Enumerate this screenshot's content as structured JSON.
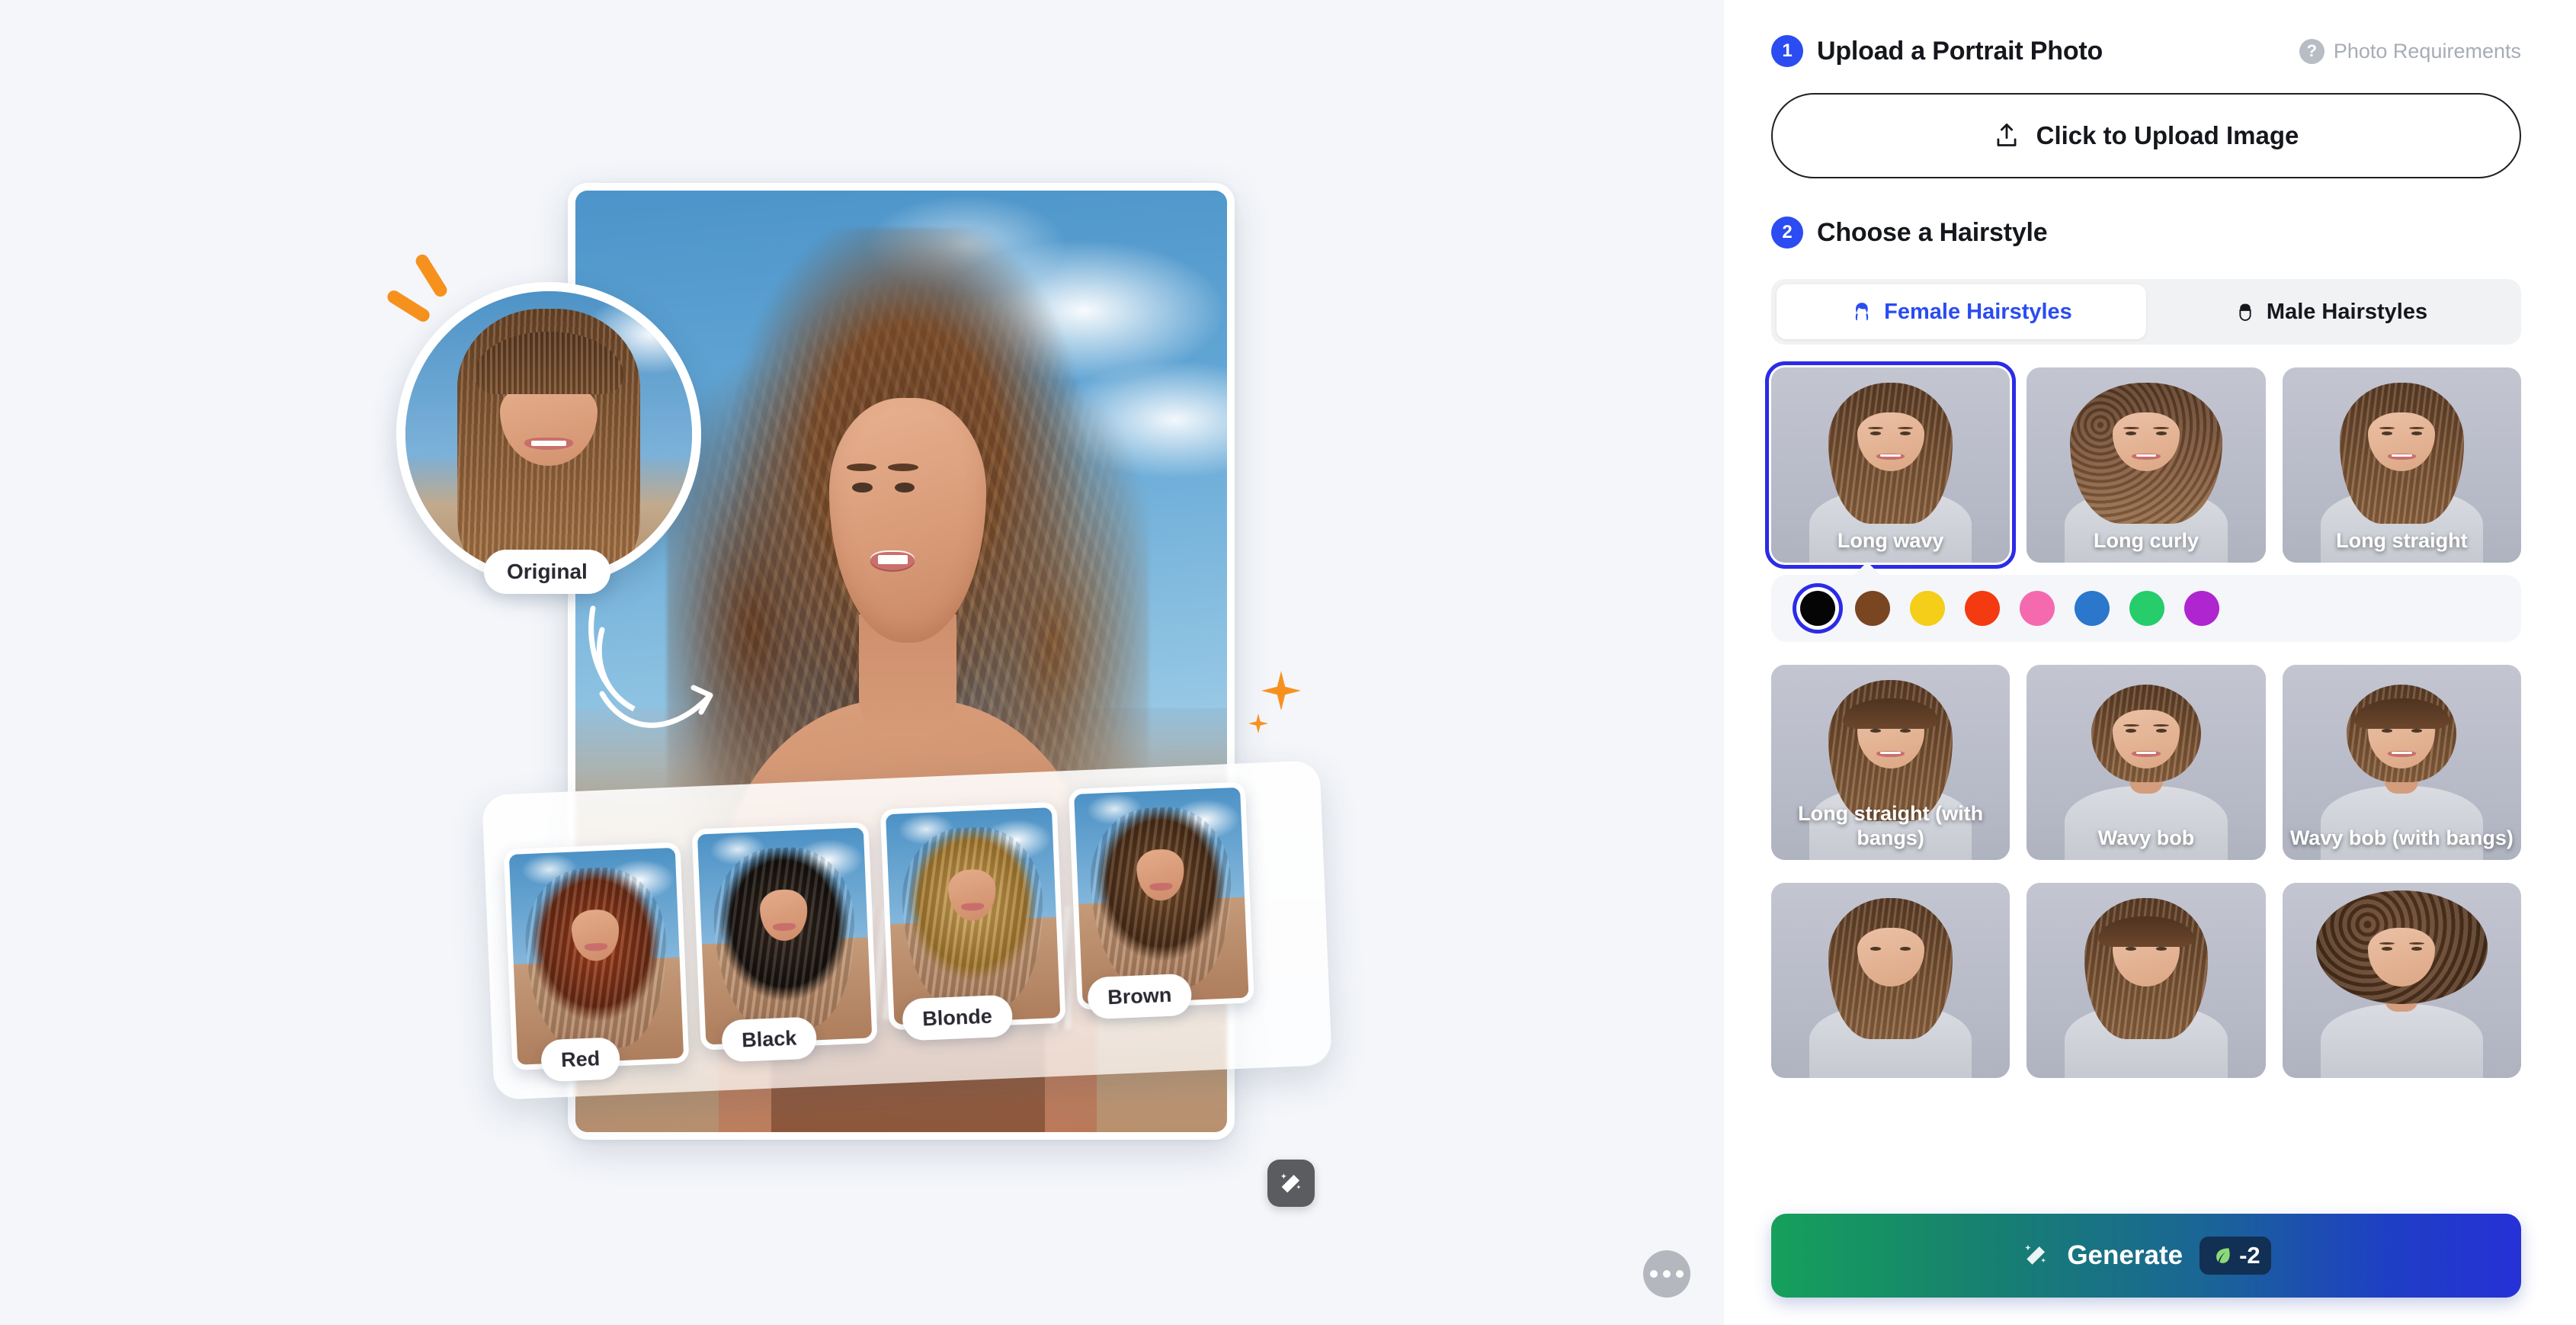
{
  "steps": {
    "one": {
      "num": "1",
      "title": "Upload a Portrait Photo"
    },
    "two": {
      "num": "2",
      "title": "Choose a Hairstyle"
    }
  },
  "photo_requirements": {
    "label": "Photo Requirements",
    "icon": "question-mark-icon"
  },
  "upload": {
    "label": "Click to Upload Image",
    "icon": "upload-icon"
  },
  "tabs": [
    {
      "label": "Female Hairstyles",
      "icon": "female-hair-icon",
      "active": true
    },
    {
      "label": "Male Hairstyles",
      "icon": "male-hair-icon",
      "active": false
    }
  ],
  "hairstyles_row1": [
    {
      "label": "Long wavy",
      "selected": true
    },
    {
      "label": "Long curly",
      "selected": false
    },
    {
      "label": "Long straight",
      "selected": false
    }
  ],
  "hairstyles_row2": [
    {
      "label": "Long straight (with bangs)",
      "selected": false
    },
    {
      "label": "Wavy bob",
      "selected": false
    },
    {
      "label": "Wavy bob (with bangs)",
      "selected": false
    }
  ],
  "hairstyles_row3": [
    {
      "label": "",
      "selected": false
    },
    {
      "label": "",
      "selected": false
    },
    {
      "label": "",
      "selected": false
    }
  ],
  "hair_colors": [
    {
      "name": "black",
      "hex": "#050505",
      "selected": true
    },
    {
      "name": "brown",
      "hex": "#7A4521",
      "selected": false
    },
    {
      "name": "yellow",
      "hex": "#F5CE19",
      "selected": false
    },
    {
      "name": "red",
      "hex": "#F43A10",
      "selected": false
    },
    {
      "name": "pink",
      "hex": "#F56AAE",
      "selected": false
    },
    {
      "name": "blue",
      "hex": "#2A77CC",
      "selected": false
    },
    {
      "name": "green",
      "hex": "#27CC6B",
      "selected": false
    },
    {
      "name": "purple",
      "hex": "#AF25CF",
      "selected": false
    }
  ],
  "generate": {
    "label": "Generate",
    "credit_cost": "-2",
    "icon": "magic-wand-icon",
    "credit_icon": "leaf-icon"
  },
  "preview": {
    "original_badge": "Original",
    "results": [
      {
        "label": "Red",
        "hair1": "#A8411F",
        "hair2": "#6B2A12"
      },
      {
        "label": "Black",
        "hair1": "#3A2A20",
        "hair2": "#15100C"
      },
      {
        "label": "Blonde",
        "hair1": "#D8AE63",
        "hair2": "#A4792F"
      },
      {
        "label": "Brown",
        "hair1": "#7A4F2C",
        "hair2": "#492C16"
      }
    ],
    "magic_button_icon": "magic-wand-icon",
    "more_button_icon": "more-horizontal-icon"
  },
  "theme": {
    "accent_blue": "#2B4CF0",
    "selection_blue": "#2B2BE8",
    "panel_bg": "#F4F6FA",
    "orange": "#F7911E"
  }
}
